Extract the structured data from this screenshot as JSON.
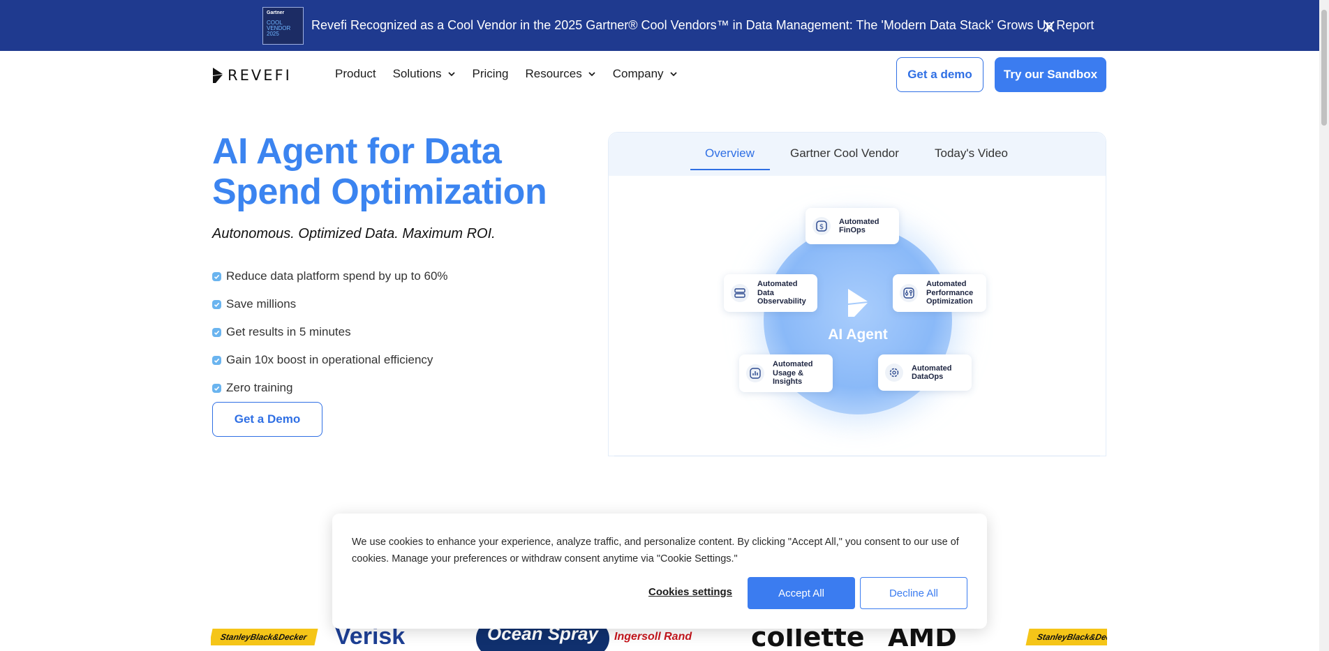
{
  "banner": {
    "badge_line1": "Gartner",
    "badge_line2": "COOL VENDOR",
    "badge_line3": "2025",
    "text": "Revefi Recognized as a Cool Vendor in the 2025 Gartner® Cool Vendors™ in Data Management: The 'Modern Data Stack' Grows Up Report",
    "close_icon": "close-icon"
  },
  "nav": {
    "logo_text": "REVEFI",
    "items": [
      {
        "label": "Product",
        "dropdown": false
      },
      {
        "label": "Solutions",
        "dropdown": true
      },
      {
        "label": "Pricing",
        "dropdown": false
      },
      {
        "label": "Resources",
        "dropdown": true
      },
      {
        "label": "Company",
        "dropdown": true
      }
    ],
    "demo_button": "Get a demo",
    "sandbox_button": "Try our Sandbox"
  },
  "hero": {
    "title": "AI Agent for Data Spend Optimization",
    "subtitle": "Autonomous. Optimized Data. Maximum ROI.",
    "bullets": [
      "Reduce data platform spend by up to 60%",
      "Save millions",
      "Get results in 5 minutes",
      "Gain 10x boost in operational efficiency",
      "Zero training"
    ],
    "cta": "Get a Demo"
  },
  "panel": {
    "tabs": [
      {
        "label": "Overview",
        "active": true
      },
      {
        "label": "Gartner Cool Vendor",
        "active": false
      },
      {
        "label": "Today's Video",
        "active": false
      }
    ],
    "diagram": {
      "center_label": "AI Agent",
      "nodes": [
        {
          "label": "Automated FinOps",
          "icon": "dollar-icon"
        },
        {
          "label": "Automated Data Observability",
          "icon": "server-icon"
        },
        {
          "label": "Automated Performance Optimization",
          "icon": "sliders-icon"
        },
        {
          "label": "Automated Usage & Insights",
          "icon": "bar-chart-icon"
        },
        {
          "label": "Automated DataOps",
          "icon": "gear-icon"
        }
      ]
    }
  },
  "cookie": {
    "text": "We use cookies to enhance your experience, analyze traffic, and personalize content. By clicking \"Accept All,\" you consent to our use of cookies. Manage your preferences or withdraw consent anytime via \"Cookie Settings.\"",
    "settings_label": "Cookies settings",
    "accept_label": "Accept All",
    "decline_label": "Decline All"
  },
  "logos": [
    "StanleyBlack&Decker",
    "Verisk",
    "Ocean Spray",
    "Ingersoll Rand",
    "collette",
    "AMD",
    "StanleyBlack&Decker"
  ],
  "colors": {
    "banner_bg": "#1f3a8f",
    "accent": "#3b7cf0",
    "hero_title": "#3b84f0"
  }
}
